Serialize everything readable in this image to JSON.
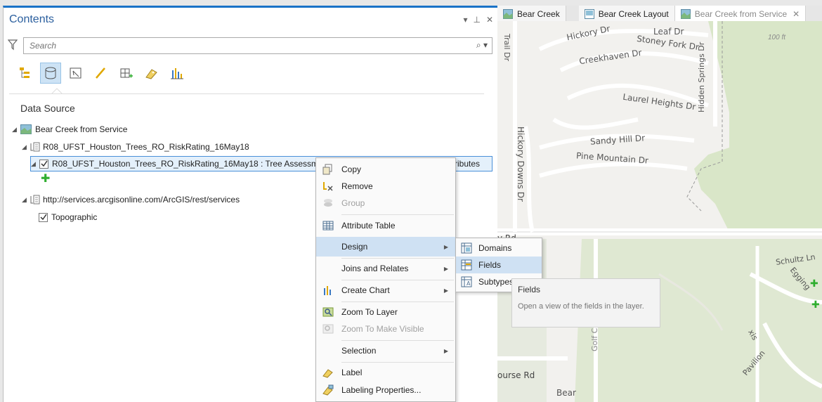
{
  "contents": {
    "title": "Contents",
    "controls": [
      "▾",
      "⊥",
      "✕"
    ],
    "search_placeholder": "Search",
    "toolbar_icons": [
      "list-by-drawing-order-icon",
      "list-by-data-source-icon",
      "list-by-selection-icon",
      "list-by-editing-icon",
      "list-by-snapping-icon",
      "list-by-labeling-icon",
      "list-by-charts-icon"
    ],
    "section_heading": "Data Source",
    "tree": {
      "root": "Bear Creek from Service",
      "source1": "R08_UFST_Houston_Trees_RO_RiskRating_16May18",
      "layer1_prefix": "R08_UFST_Houston_Trees_RO_RiskRating_16May18 : Tree Assessments",
      "layer1_suffix": "ributes",
      "source2": "http://services.arcgisonline.com/ArcGIS/rest/services",
      "layer2": "Topographic"
    }
  },
  "map_tabs": [
    {
      "label": "Bear Creek",
      "close": ""
    },
    {
      "label": "Bear Creek Layout",
      "close": ""
    },
    {
      "label": "Bear Creek from Service",
      "close": "✕"
    }
  ],
  "map_labels": {
    "hickory_dr": "Hickory Dr",
    "leaf_dr": "Leaf Dr",
    "stoney_fork": "Stoney Fork Dr",
    "creekhaven": "Creekhaven Dr",
    "laurel_heights": "Laurel Heights Dr",
    "hidden_springs": "Hidden Springs Dr",
    "trail_dr": "Trail Dr",
    "sandy_hill": "Sandy Hill Dr",
    "pine_mountain": "Pine Mountain Dr",
    "hickory_downs": "Hickory Downs Dr",
    "y_rd": "y Rd",
    "schultz": "Schultz Ln",
    "egging": "Egging",
    "golf_course": "Golf Course Dr",
    "course_rd": "ourse Rd",
    "bear": "Bear",
    "elev": "100 ft",
    "xis": "xis",
    "pavilion": "Pavilion"
  },
  "context_menu": {
    "items": [
      {
        "label": "Copy",
        "icon": "copy-icon",
        "disabled": false
      },
      {
        "label": "Remove",
        "icon": "remove-icon",
        "disabled": false
      },
      {
        "label": "Group",
        "icon": "group-icon",
        "disabled": true
      },
      {
        "label": "Attribute Table",
        "icon": "table-icon",
        "disabled": false
      },
      {
        "label": "Design",
        "icon": "",
        "disabled": false
      },
      {
        "label": "Joins and Relates",
        "icon": "",
        "disabled": false
      },
      {
        "label": "Create Chart",
        "icon": "chart-icon",
        "disabled": false
      },
      {
        "label": "Zoom To Layer",
        "icon": "zoom-layer-icon",
        "disabled": false
      },
      {
        "label": "Zoom To Make Visible",
        "icon": "zoom-visible-icon",
        "disabled": true
      },
      {
        "label": "Selection",
        "icon": "",
        "disabled": false
      },
      {
        "label": "Label",
        "icon": "label-icon",
        "disabled": false
      },
      {
        "label": "Labeling Properties...",
        "icon": "labeling-properties-icon",
        "disabled": false
      }
    ]
  },
  "submenu": {
    "items": [
      {
        "label": "Domains",
        "icon": "domains-icon"
      },
      {
        "label": "Fields",
        "icon": "fields-icon"
      },
      {
        "label": "Subtypes",
        "icon": "subtypes-icon"
      }
    ]
  },
  "tooltip": {
    "title": "Fields",
    "body": "Open a view of the fields in the layer."
  },
  "colors": {
    "accent": "#1a73c8",
    "highlight": "#cfe1f3",
    "map_bg": "#f3f2ef",
    "map_green": "#d9e6c8",
    "plus_green": "#2fae2f"
  }
}
